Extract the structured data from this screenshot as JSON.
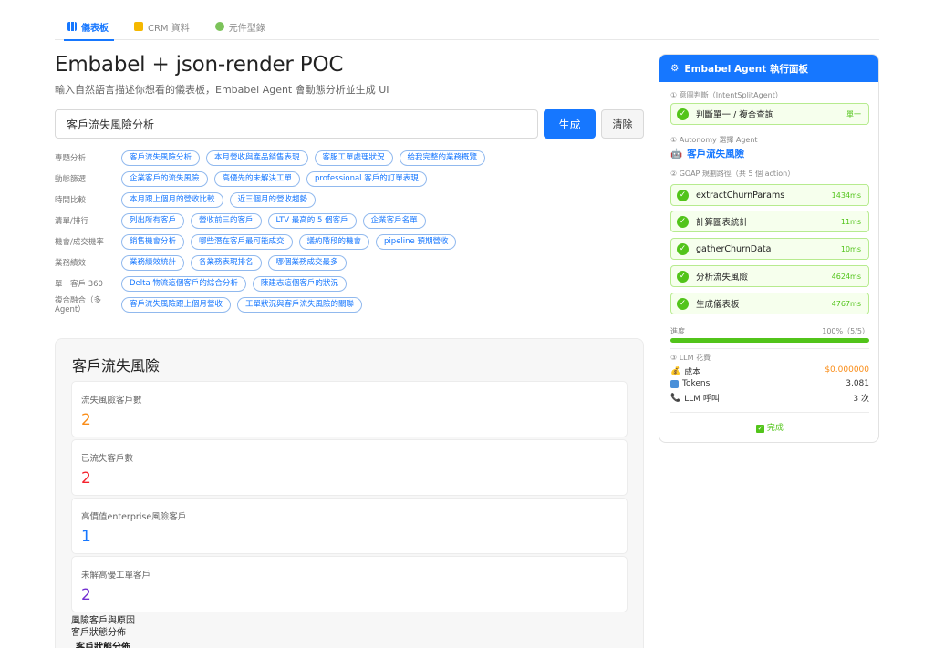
{
  "nav": {
    "tabs": [
      {
        "label": "儀表板",
        "active": true
      },
      {
        "label": "CRM 資料",
        "active": false
      },
      {
        "label": "元件型錄",
        "active": false
      }
    ]
  },
  "header": {
    "title": "Embabel + json-render POC",
    "subtitle": "輸入自然語言描述你想看的儀表板，Embabel Agent 會動態分析並生成 UI"
  },
  "search": {
    "value": "客戶流失風險分析",
    "generate_label": "生成",
    "clear_label": "清除"
  },
  "categories": [
    {
      "label": "專題分析",
      "chips": [
        "客戶流失風險分析",
        "本月營收與產品銷售表現",
        "客服工單處理狀況",
        "給我完整的業務概覽"
      ]
    },
    {
      "label": "動態篩選",
      "chips": [
        "企業客戶的流失風險",
        "高優先的未解決工單",
        "professional 客戶的訂單表現"
      ]
    },
    {
      "label": "時間比較",
      "chips": [
        "本月跟上個月的營收比較",
        "近三個月的營收趨勢"
      ]
    },
    {
      "label": "清單/排行",
      "chips": [
        "列出所有客戶",
        "營收前三的客戶",
        "LTV 最高的 5 個客戶",
        "企業客戶名單"
      ]
    },
    {
      "label": "機會/成交機率",
      "chips": [
        "銷售機會分析",
        "哪些潛在客戶最可能成交",
        "議約階段的機會",
        "pipeline 預期營收"
      ]
    },
    {
      "label": "業務績效",
      "chips": [
        "業務績效統計",
        "各業務表現排名",
        "哪個業務成交最多"
      ]
    },
    {
      "label": "單一客戶 360",
      "chips": [
        "Delta 物流這個客戶的綜合分析",
        "陳建志這個客戶的狀況"
      ]
    },
    {
      "label": "複合融合（多 Agent）",
      "chips": [
        "客戶流失風險跟上個月營收",
        "工單狀況與客戶流失風險的關聯"
      ]
    }
  ],
  "result": {
    "title": "客戶流失風險",
    "stats": [
      {
        "label": "流失風險客戶數",
        "value": "2",
        "color": "#fa8c16"
      },
      {
        "label": "已流失客戶數",
        "value": "2",
        "color": "#f5222d"
      },
      {
        "label": "高價值enterprise風險客戶",
        "value": "1",
        "color": "#1677ff"
      },
      {
        "label": "未解高優工單客戶",
        "value": "2",
        "color": "#722ed1"
      }
    ],
    "section_1": "風險客戶與原因",
    "section_2": "客戶狀態分佈",
    "section_3": "客戶狀態分佈"
  },
  "agent": {
    "title": "Embabel Agent 執行面板",
    "intent_label": "① 意圖判斷（IntentSplitAgent）",
    "intent_step": {
      "name": "判斷單一 / 複合查詢",
      "result": "單一"
    },
    "autonomy_label": "① Autonomy 選擇 Agent",
    "selected_agent": "客戶流失風險",
    "goap_label": "② GOAP 規劃路徑（共 5 個 action）",
    "actions": [
      {
        "name": "extractChurnParams",
        "time": "1434ms"
      },
      {
        "name": "計算圖表統計",
        "time": "11ms"
      },
      {
        "name": "gatherChurnData",
        "time": "10ms"
      },
      {
        "name": "分析流失風險",
        "time": "4624ms"
      },
      {
        "name": "生成儀表板",
        "time": "4767ms"
      }
    ],
    "progress_label": "進度",
    "progress_text": "100%（5/5）",
    "progress_value": 1.0,
    "cost_label": "③ LLM 花費",
    "cost": [
      {
        "key": "成本",
        "value": "$0.000000",
        "icon": "money-bag-icon"
      },
      {
        "key": "Tokens",
        "value": "3,081",
        "icon": "tokens-icon"
      },
      {
        "key": "LLM 呼叫",
        "value": "3 次",
        "icon": "phone-icon"
      }
    ],
    "done_label": "完成"
  }
}
